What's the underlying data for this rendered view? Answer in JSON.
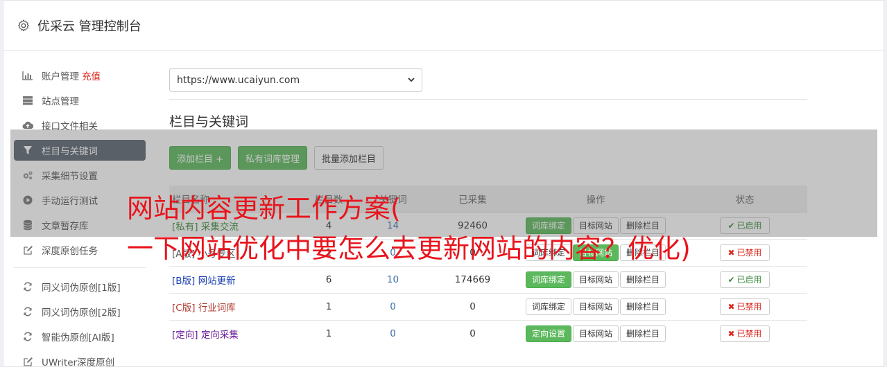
{
  "header": {
    "title": "优采云 管理控制台",
    "icon": "gear-icon"
  },
  "sidebar": {
    "items": [
      {
        "label": "账户管理",
        "badge": "充值",
        "icon": "bar-chart-icon"
      },
      {
        "label": "站点管理",
        "icon": "server-icon"
      },
      {
        "label": "接口文件相关",
        "icon": "cloud-upload-icon"
      },
      {
        "label": "栏目与关键词",
        "icon": "filter-icon",
        "active": true
      },
      {
        "label": "采集细节设置",
        "icon": "cogs-icon"
      },
      {
        "label": "手动运行测试",
        "icon": "play-circle-icon"
      },
      {
        "label": "文章暂存库",
        "icon": "database-icon"
      },
      {
        "label": "深度原创任务",
        "icon": "edit-icon"
      },
      {
        "label": "同义词伪原创[1版]",
        "icon": "refresh-icon"
      },
      {
        "label": "同义词伪原创[2版]",
        "icon": "refresh-icon"
      },
      {
        "label": "智能伪原创[AI版]",
        "icon": "refresh-icon"
      },
      {
        "label": "UWriter深度原创",
        "icon": "edit-icon"
      }
    ]
  },
  "main": {
    "site_select": {
      "value": "https://www.ucaiyun.com"
    },
    "section_title": "栏目与关键词",
    "buttons": {
      "add": "添加栏目 +",
      "private_lib": "私有词库管理",
      "batch_add": "批量添加栏目"
    },
    "table": {
      "headers": {
        "name": "栏目名称",
        "count": "栏目数",
        "keywords": "关键词",
        "collected": "已采集",
        "actions": "操作",
        "status": "状态"
      },
      "rows": [
        {
          "tag": "[私有]",
          "name": "采集交流",
          "count": "4",
          "keywords": "14",
          "collected": "92460",
          "btn1": "词库绑定",
          "btn1_green": true,
          "btn2": "目标网站",
          "btn3": "删除栏目",
          "status": "已启用",
          "enabled": true,
          "color": "#3c8d3c"
        },
        {
          "tag": "[A版]",
          "name": "小号专区",
          "count": "1",
          "keywords": "0",
          "collected": "0",
          "btn1": "词库绑定",
          "btn1_green": false,
          "btn2": "目标网站",
          "btn2_green": true,
          "btn3": "删除栏目",
          "status": "已禁用",
          "enabled": false,
          "color": "#555555"
        },
        {
          "tag": "[B版]",
          "name": "网站更新",
          "count": "6",
          "keywords": "10",
          "collected": "174669",
          "btn1": "词库绑定",
          "btn1_green": true,
          "btn2": "目标网站",
          "btn3": "删除栏目",
          "status": "已启用",
          "enabled": true,
          "color": "#1a3fb0"
        },
        {
          "tag": "[C版]",
          "name": "行业词库",
          "count": "1",
          "keywords": "0",
          "collected": "0",
          "btn1": "词库绑定",
          "btn1_green": false,
          "btn2": "目标网站",
          "btn3": "删除栏目",
          "status": "已禁用",
          "enabled": false,
          "color": "#b03a2e"
        },
        {
          "tag": "[定向]",
          "name": "定向采集",
          "count": "1",
          "keywords": "0",
          "collected": "0",
          "btn1": "定向设置",
          "btn1_green": true,
          "btn2": "目标网站",
          "btn3": "删除栏目",
          "status": "已禁用",
          "enabled": false,
          "color": "#6a1b9a"
        }
      ]
    }
  },
  "overlay": {
    "line1": "网站内容更新工作方案(",
    "line2": "一下网站优化中要怎么去更新网站的内容？优化)"
  },
  "colors": {
    "accent_green": "#5cb85c",
    "active_nav": "#5a6570",
    "overlay_text": "#e8141c",
    "enabled": "#3c8d3c",
    "disabled": "#d9261c"
  }
}
